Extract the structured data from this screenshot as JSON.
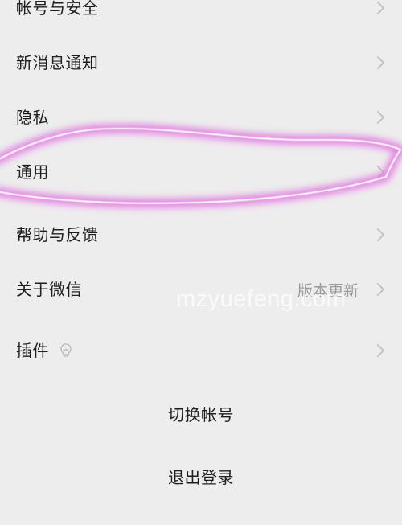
{
  "settings": {
    "items": [
      {
        "label": "帐号与安全"
      },
      {
        "label": "新消息通知"
      },
      {
        "label": "隐私"
      },
      {
        "label": "通用"
      },
      {
        "label": "帮助与反馈"
      },
      {
        "label": "关于微信",
        "value": "版本更新"
      },
      {
        "label": "插件"
      }
    ],
    "switch_account": "切换帐号",
    "logout": "退出登录"
  },
  "watermark": "mzyuefeng.com",
  "colors": {
    "background": "#ededed",
    "text": "#1f1f1f",
    "secondary_text": "#9a9a9a",
    "chevron": "#c4c4c4",
    "highlight": "#e26be1"
  }
}
